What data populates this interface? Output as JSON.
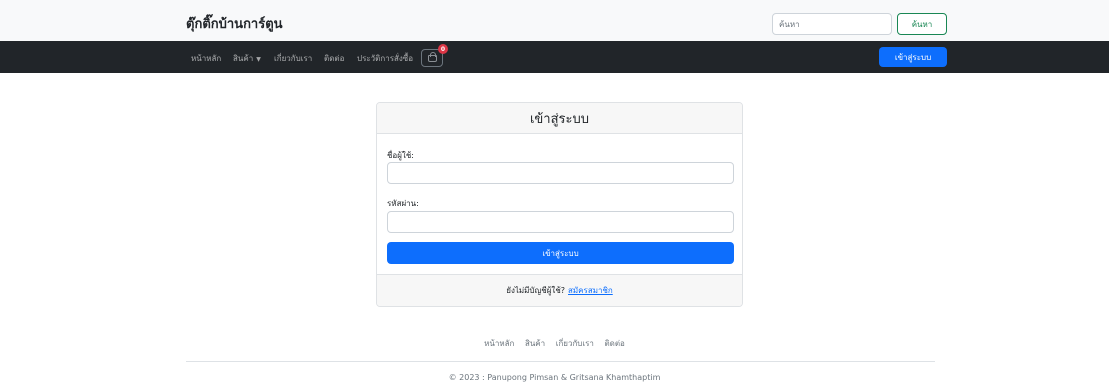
{
  "header": {
    "brand": "ตุ๊กติ๊กบ้านการ์ตูน",
    "search_placeholder": "ค้นหา",
    "search_button": "ค้นหา"
  },
  "nav": {
    "items": [
      "หน้าหลัก",
      "สินค้า",
      "เกี่ยวกับเรา",
      "ติดต่อ",
      "ประวัติการสั่งซื้อ"
    ],
    "cart_count": "0",
    "login_button": "เข้าสู่ระบบ"
  },
  "login_card": {
    "title": "เข้าสู่ระบบ",
    "username_label": "ชื่อผู้ใช้:",
    "password_label": "รหัสผ่าน:",
    "submit_button": "เข้าสู่ระบบ",
    "no_account_text": "ยังไม่มีบัญชีผู้ใช้?",
    "signup_link": "สมัครสมาชิก"
  },
  "footer": {
    "links": [
      "หน้าหลัก",
      "สินค้า",
      "เกี่ยวกับเรา",
      "ติดต่อ"
    ],
    "copyright": "© 2023 : Panupong Pimsan & Gritsana Khamthaptim"
  }
}
